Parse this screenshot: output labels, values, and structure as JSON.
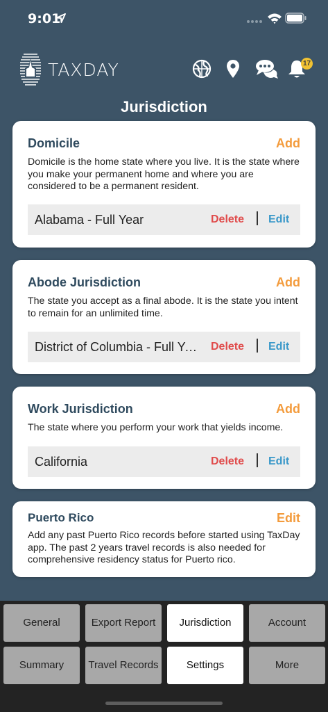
{
  "status": {
    "time": "9:01"
  },
  "app": {
    "brand": "TAXDAY",
    "notification_count": "17"
  },
  "page": {
    "title": "Jurisdiction"
  },
  "cards": [
    {
      "title": "Domicile",
      "action": "Add",
      "description": "Domicile is the home state where you live. It is the state where you make your permanent home and where you are considered to be a permanent resident.",
      "row": {
        "value": "Alabama - Full Year",
        "delete": "Delete",
        "edit": "Edit"
      }
    },
    {
      "title": "Abode Jurisdiction",
      "action": "Add",
      "description": "The state you accept as a final abode. It is the state you intent to remain for an unlimited time.",
      "row": {
        "value": "District of Columbia - Full Year",
        "delete": "Delete",
        "edit": "Edit"
      }
    },
    {
      "title": "Work Jurisdiction",
      "action": "Add",
      "description": "The state where you perform your work that yields income.",
      "row": {
        "value": "California",
        "delete": "Delete",
        "edit": "Edit"
      }
    },
    {
      "title": "Puerto Rico",
      "action": "Edit",
      "description": "Add any past Puerto Rico records before started using TaxDay app. The past 2 years travel records is also needed for comprehensive residency status for Puerto rico."
    }
  ],
  "tabs": [
    {
      "label": "General"
    },
    {
      "label": "Export Report"
    },
    {
      "label": "Jurisdiction"
    },
    {
      "label": "Account"
    },
    {
      "label": "Summary"
    },
    {
      "label": "Travel Records"
    },
    {
      "label": "Settings"
    },
    {
      "label": "More"
    }
  ],
  "colors": {
    "background": "#3d5467",
    "title": "#2f4a5e",
    "add": "#f39b3c",
    "delete": "#e04b4b",
    "edit": "#3a98c9"
  }
}
